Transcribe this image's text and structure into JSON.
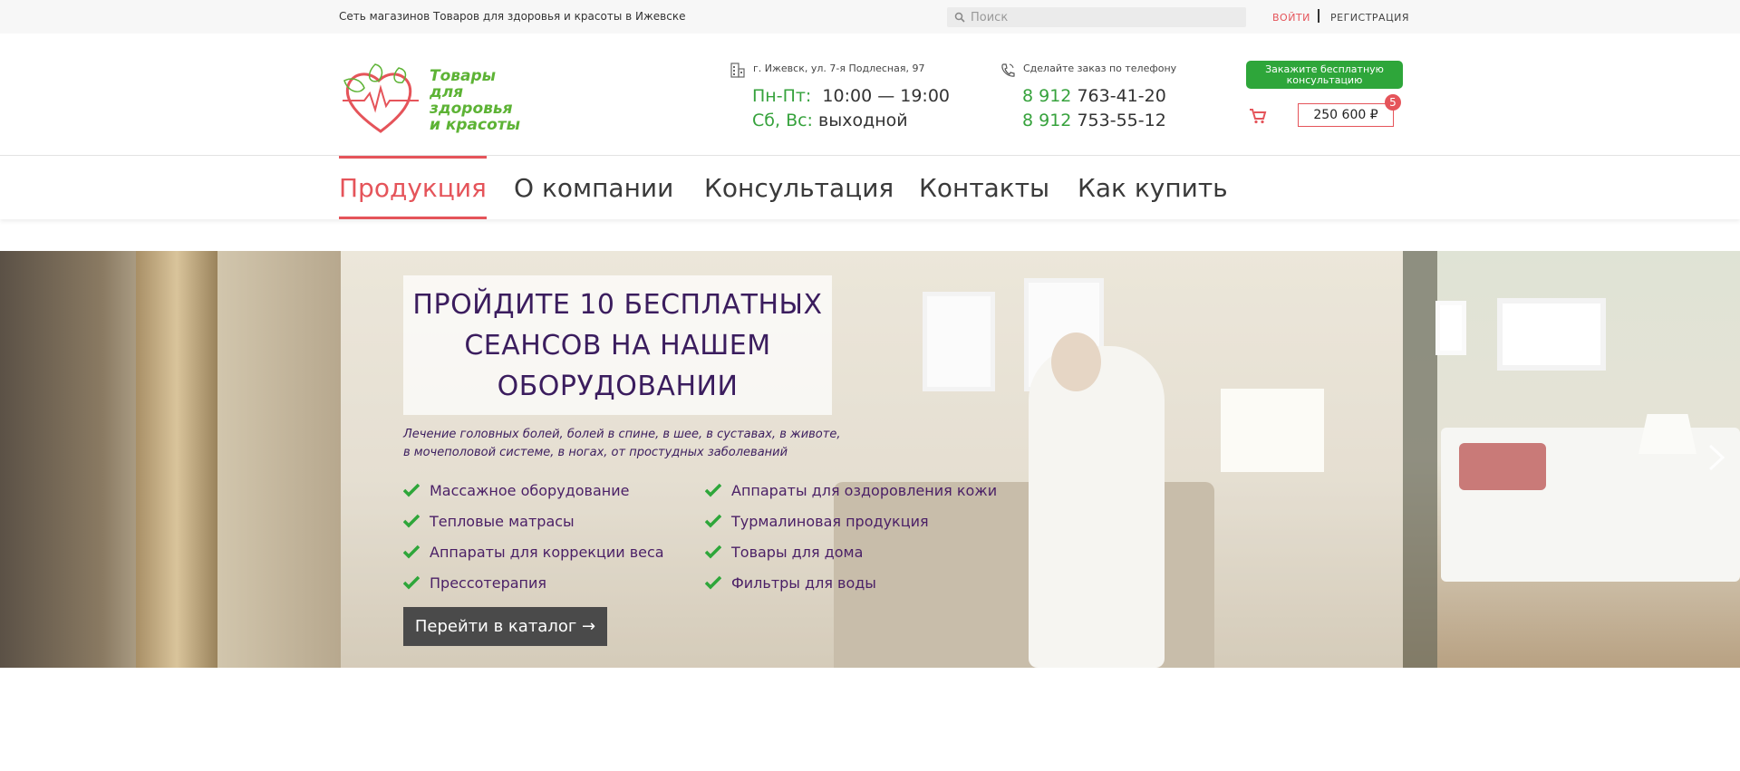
{
  "topbar": {
    "tagline": "Сеть магазинов Товаров для здоровья и красоты в Ижевске",
    "search_placeholder": "Поиск",
    "login": "ВОЙТИ",
    "register": "РЕГИСТРАЦИЯ"
  },
  "header": {
    "logo_lines": [
      "Товары",
      "для здоровья",
      "и красоты"
    ],
    "address": "г. Ижевск, ул. 7-я Подлесная, 97",
    "hours": [
      {
        "label": "Пн-Пт:",
        "value": "10:00 — 19:00"
      },
      {
        "label": "Сб, Вс:",
        "value": "выходной"
      }
    ],
    "phone_caption": "Сделайте заказ по телефону",
    "phones": [
      {
        "code": "8 912",
        "number": "763-41-20"
      },
      {
        "code": "8 912",
        "number": "753-55-12"
      }
    ],
    "consult_button": "Закажите бесплатную консультацию",
    "cart_total": "250 600 ₽",
    "cart_count": "5"
  },
  "nav": {
    "items": [
      "Продукция",
      "О компании",
      "Консультация",
      "Контакты",
      "Как купить"
    ],
    "active_index": 0
  },
  "hero": {
    "title": "ПРОЙДИТЕ 10 БЕСПЛАТНЫХ СЕАНСОВ НА НАШЕМ ОБОРУДОВАНИИ",
    "description_lines": [
      "Лечение головных болей, болей в спине, в шее, в суставах, в животе,",
      "в мочеполовой системе, в ногах, от простудных заболеваний"
    ],
    "list_col1": [
      "Массажное оборудование",
      "Тепловые матрасы",
      "Аппараты для коррекции веса",
      "Прессотерапия"
    ],
    "list_col2": [
      "Аппараты для оздоровления кожи",
      "Турмалиновая продукция",
      "Товары для дома",
      "Фильтры для воды"
    ],
    "cta": "Перейти в каталог →"
  },
  "colors": {
    "accent_red": "#e5545a",
    "brand_green": "#36a23c",
    "hero_text": "#3b1d5e"
  }
}
